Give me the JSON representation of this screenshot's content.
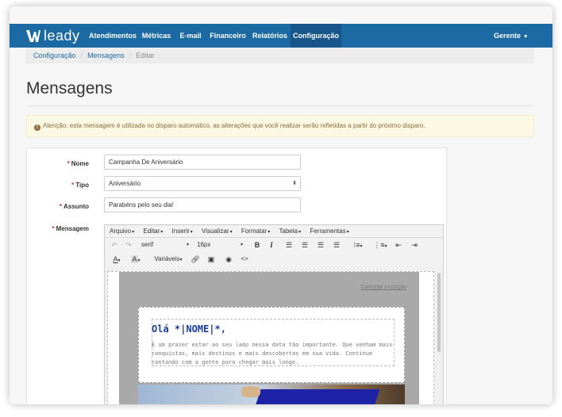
{
  "app": {
    "brand": "leady",
    "brand_color": "#1c6aa3"
  },
  "nav": {
    "items": [
      {
        "label": "Atendimentos",
        "active": false
      },
      {
        "label": "Métricas",
        "active": false
      },
      {
        "label": "E-mail",
        "active": false
      },
      {
        "label": "Financeiro",
        "active": false
      },
      {
        "label": "Relatórios",
        "active": false
      },
      {
        "label": "Configuração",
        "active": true
      }
    ],
    "user": "Gerente"
  },
  "breadcrumb": {
    "items": [
      {
        "label": "Configuração",
        "link": true
      },
      {
        "label": "Mensagens",
        "link": true
      },
      {
        "label": "Editar",
        "link": false
      }
    ]
  },
  "page": {
    "title": "Mensagens"
  },
  "alert": {
    "text": "Atenção: esta mensagem é utilizada no disparo automático, as alterações que você realizar serão refletidas a partir do próximo disparo."
  },
  "form": {
    "nome_label": "Nome",
    "nome_value": "Campanha De Aniversário",
    "tipo_label": "Tipo",
    "tipo_value": "Aniversário",
    "assunto_label": "Assunto",
    "assunto_value": "Parabéns pelo seu dia!",
    "mensagem_label": "Mensagem"
  },
  "editor": {
    "menus": [
      "Arquivo",
      "Editar",
      "Inserir",
      "Visualizar",
      "Formatar",
      "Tabela",
      "Ferramentas"
    ],
    "font_family": "serif",
    "font_size": "16px",
    "variables_label": "Variáveis",
    "content": {
      "unsubscribe": "Cancelar inscrição",
      "greeting": "Olá *|NOME|*,",
      "body": "É um prazer estar ao seu lado nessa data tão importante. Que venham mais conquistas, mais destinos e mais descobertas em sua vida. Continue contando com a gente para chegar mais longe."
    }
  }
}
